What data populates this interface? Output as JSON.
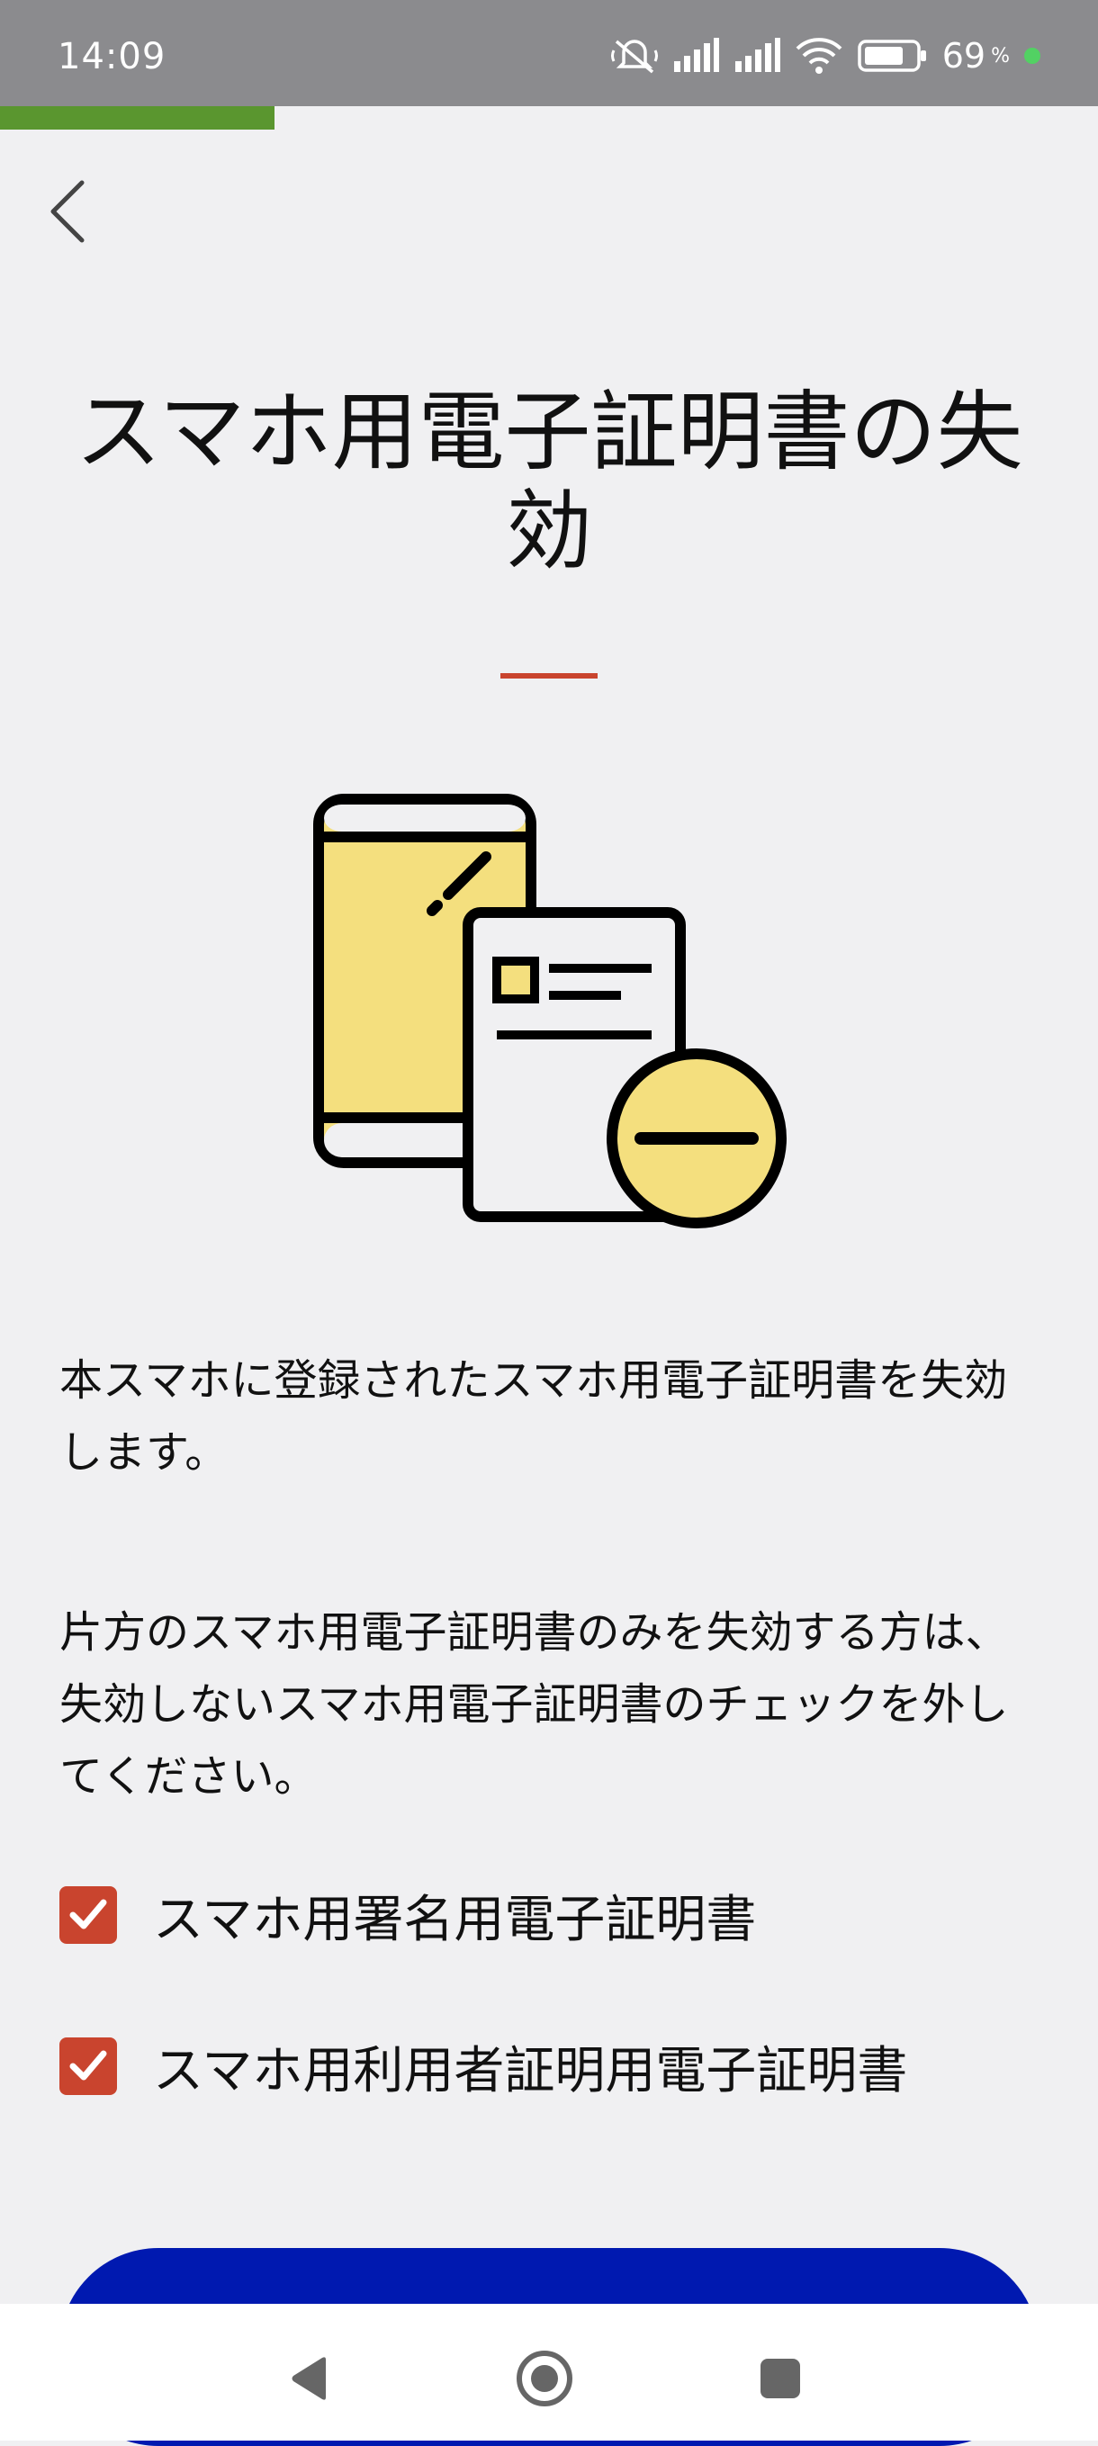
{
  "status_bar": {
    "time": "14:09",
    "battery_text": "69",
    "battery_unit": "%",
    "icons": [
      "mute-vibrate-icon",
      "signal-icon",
      "signal-icon",
      "wifi-icon",
      "battery-icon",
      "active-dot-icon"
    ]
  },
  "progress": {
    "fraction": 0.25,
    "color": "#5a962f"
  },
  "header": {
    "back_icon": "chevron-left-icon"
  },
  "title": "スマホ用電子証明書の失効",
  "illustration": {
    "icon": "phone-certificate-revoke-icon"
  },
  "paragraphs": [
    "本スマホに登録されたスマホ用電子証明書を失効します。",
    "片方のスマホ用電子証明書のみを失効する方は、失効しないスマホ用電子証明書のチェックを外してください。"
  ],
  "checkboxes": [
    {
      "label": "スマホ用署名用電子証明書",
      "checked": true
    },
    {
      "label": "スマホ用利用者証明用電子証明書",
      "checked": true
    }
  ],
  "primary_button": {
    "color": "#0019b0"
  },
  "colors": {
    "accent": "#c9442e",
    "primary": "#0019b0",
    "illustration_yellow": "#f4df7e"
  },
  "nav_bar": {
    "icons": [
      "nav-back-icon",
      "nav-home-icon",
      "nav-recents-icon"
    ]
  }
}
